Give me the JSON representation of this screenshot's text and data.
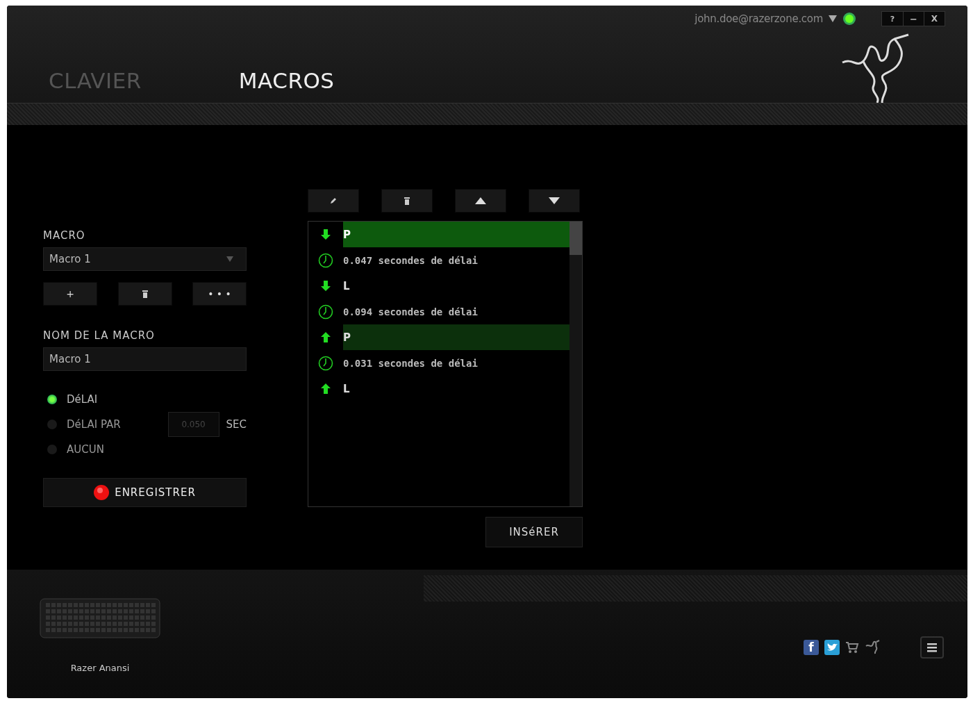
{
  "window": {
    "user": "john.doe@razerzone.com",
    "controls": [
      {
        "kind": "help",
        "glyph": "?"
      },
      {
        "kind": "minimize",
        "glyph": "−"
      },
      {
        "kind": "close",
        "glyph": "X"
      }
    ]
  },
  "tabs": [
    {
      "label": "CLAVIER",
      "selected": false
    },
    {
      "label": "MACROS",
      "selected": true
    }
  ],
  "macro_panel": {
    "macro_label": "MACRO",
    "macro_select": "Macro 1",
    "actions": [
      {
        "kind": "add",
        "glyph": "+"
      },
      {
        "kind": "delete"
      },
      {
        "kind": "more",
        "glyph": "• • •"
      }
    ],
    "name_label": "NOM DE LA MACRO",
    "name_value": "Macro 1",
    "delay_options": [
      {
        "label": "DéLAI",
        "selected": true
      },
      {
        "label": "DéLAI PAR",
        "selected": false,
        "value": "0.050",
        "unit": "SEC"
      },
      {
        "label": "AUCUN",
        "selected": false
      }
    ],
    "record_button": "ENREGISTRER"
  },
  "editor": {
    "toolbar": [
      {
        "kind": "edit"
      },
      {
        "kind": "delete"
      },
      {
        "kind": "up"
      },
      {
        "kind": "down"
      }
    ],
    "events": [
      {
        "kind": "keydown",
        "text": "P",
        "selected": true,
        "hovered": false
      },
      {
        "kind": "delay",
        "text": "0.047 secondes de délai",
        "selected": false,
        "hovered": false
      },
      {
        "kind": "keydown",
        "text": "L",
        "selected": false,
        "hovered": false
      },
      {
        "kind": "delay",
        "text": "0.094 secondes de délai",
        "selected": false,
        "hovered": false
      },
      {
        "kind": "keyup",
        "text": "P",
        "selected": false,
        "hovered": true
      },
      {
        "kind": "delay",
        "text": "0.031 secondes de délai",
        "selected": false,
        "hovered": false
      },
      {
        "kind": "keyup",
        "text": "L",
        "selected": false,
        "hovered": false
      }
    ],
    "insert_button": "INSéRER"
  },
  "footer": {
    "device": "Razer Anansi",
    "links": [
      {
        "kind": "facebook",
        "glyph": "f"
      },
      {
        "kind": "twitter"
      },
      {
        "kind": "store"
      },
      {
        "kind": "razer"
      },
      {
        "kind": "menu"
      }
    ]
  }
}
